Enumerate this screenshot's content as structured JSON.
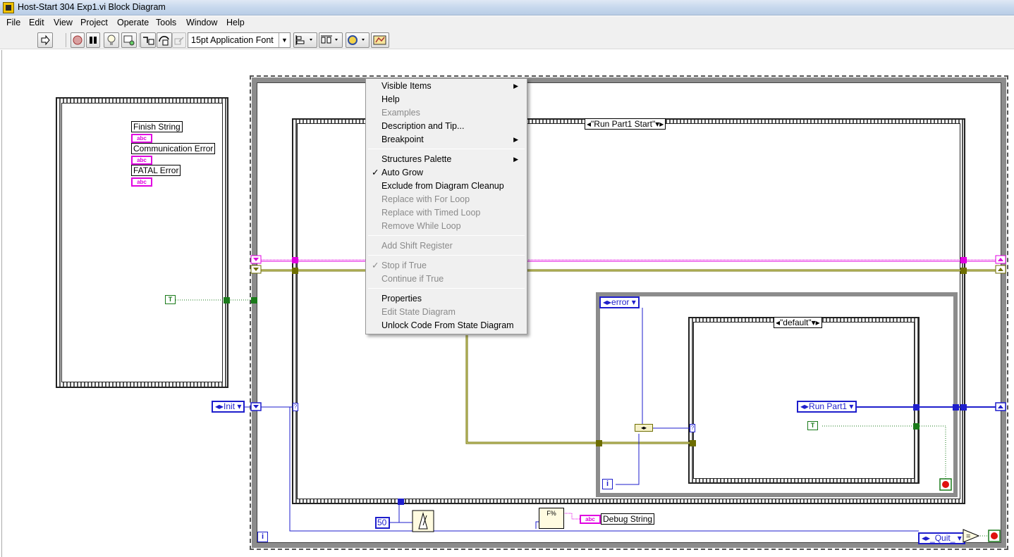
{
  "window": {
    "title": "Host-Start 304 Exp1.vi Block Diagram"
  },
  "menu": [
    "File",
    "Edit",
    "View",
    "Project",
    "Operate",
    "Tools",
    "Window",
    "Help"
  ],
  "toolbar": {
    "font": "15pt Application Font"
  },
  "error_cluster": {
    "labels": [
      "Finish String",
      "Communication Error",
      "FATAL Error"
    ],
    "abc_icon": "abc"
  },
  "constants": {
    "bool_true": "T",
    "init_enum": "Init",
    "error_enum": "error",
    "run_part1_enum": "Run Part1",
    "quit_enum": "_Quit_",
    "wait_ms": "50",
    "iteration_outer": "i",
    "iteration_inner": "i",
    "debug_string": "Debug String",
    "format_icon": "F%"
  },
  "case_structures": {
    "outer_selector": "\"Run Part1 Start\"",
    "inner_selector": "\"default\""
  },
  "context_menu": {
    "items": [
      {
        "label": "Visible Items",
        "submenu": true,
        "disabled": false
      },
      {
        "label": "Help",
        "disabled": false
      },
      {
        "label": "Examples",
        "disabled": true
      },
      {
        "label": "Description and Tip...",
        "disabled": false
      },
      {
        "label": "Breakpoint",
        "submenu": true,
        "disabled": false
      },
      {
        "label": "Structures Palette",
        "submenu": true,
        "disabled": false
      },
      {
        "label": "Auto Grow",
        "checked": true,
        "disabled": false
      },
      {
        "label": "Exclude from Diagram Cleanup",
        "disabled": false
      },
      {
        "label": "Replace with For Loop",
        "disabled": true
      },
      {
        "label": "Replace with Timed Loop",
        "disabled": true
      },
      {
        "label": "Remove While Loop",
        "disabled": true
      },
      {
        "label": "Add Shift Register",
        "disabled": true
      },
      {
        "label": "Stop if True",
        "checked": true,
        "disabled": true
      },
      {
        "label": "Continue if True",
        "disabled": true
      },
      {
        "label": "Properties",
        "disabled": false
      },
      {
        "label": "Edit State Diagram",
        "disabled": true
      },
      {
        "label": "Unlock Code From State Diagram",
        "disabled": false
      }
    ]
  },
  "colors": {
    "string_wire": "#e000e0",
    "error_wire": "#6e6e00",
    "enum_wire": "#1e1ecc",
    "bool_wire": "#1a7a1a",
    "stop_red": "#e01010"
  }
}
